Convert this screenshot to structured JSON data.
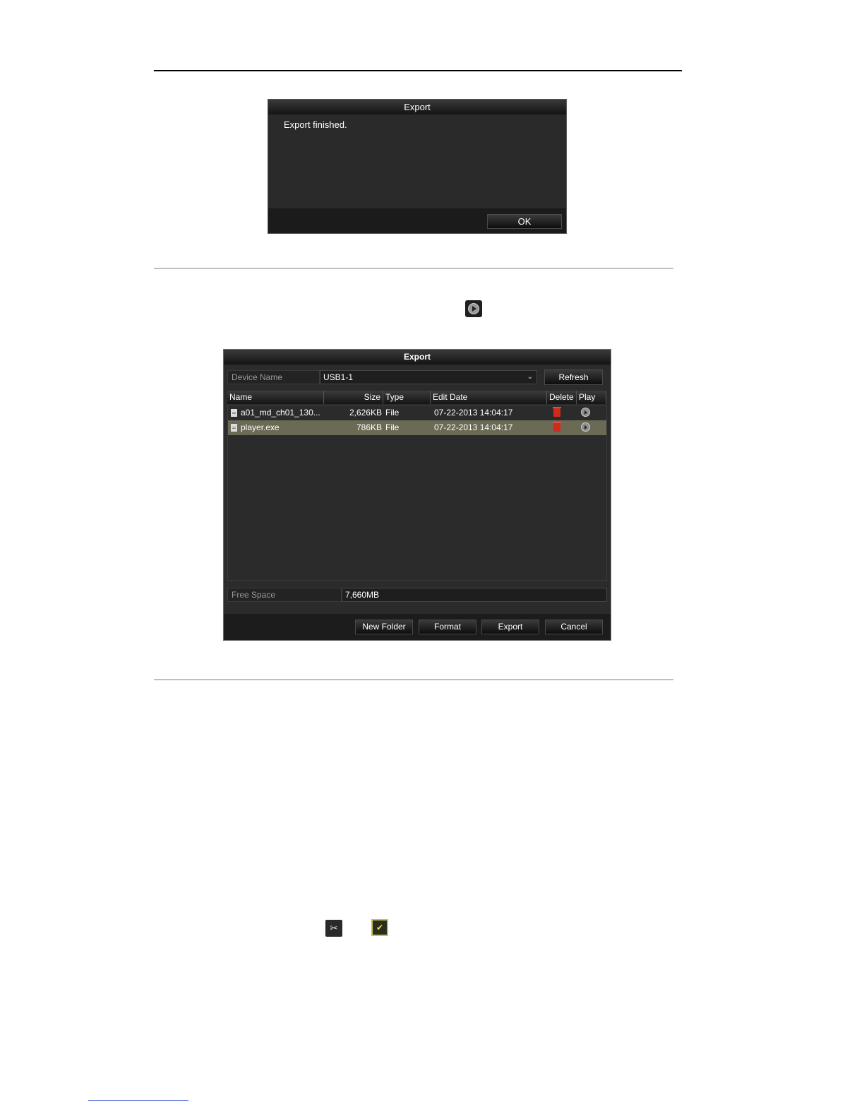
{
  "export_finished_dialog": {
    "title": "Export",
    "message": "Export finished.",
    "ok_label": "OK"
  },
  "export_dialog": {
    "title": "Export",
    "device_name_label": "Device Name",
    "device_name_value": "USB1-1",
    "refresh_label": "Refresh",
    "columns": {
      "name": "Name",
      "size": "Size",
      "type": "Type",
      "edit_date": "Edit Date",
      "delete": "Delete",
      "play": "Play"
    },
    "files": [
      {
        "name": "a01_md_ch01_130...",
        "size": "2,626KB",
        "type": "File",
        "edit_date": "07-22-2013 14:04:17"
      },
      {
        "name": "player.exe",
        "size": "786KB",
        "type": "File",
        "edit_date": "07-22-2013 14:04:17",
        "selected": true
      }
    ],
    "free_space_label": "Free Space",
    "free_space_value": "7,660MB",
    "buttons": {
      "new_folder": "New Folder",
      "format": "Format",
      "export": "Export",
      "cancel": "Cancel"
    }
  },
  "icons": {
    "inline_play": "play-icon",
    "clip": "scissors-icon",
    "clip_done": "scissors-check-icon"
  },
  "colors": {
    "dialog_bg": "#2b2b2b",
    "selected_row": "#6b6a55",
    "delete_icon": "#d02a1a"
  }
}
